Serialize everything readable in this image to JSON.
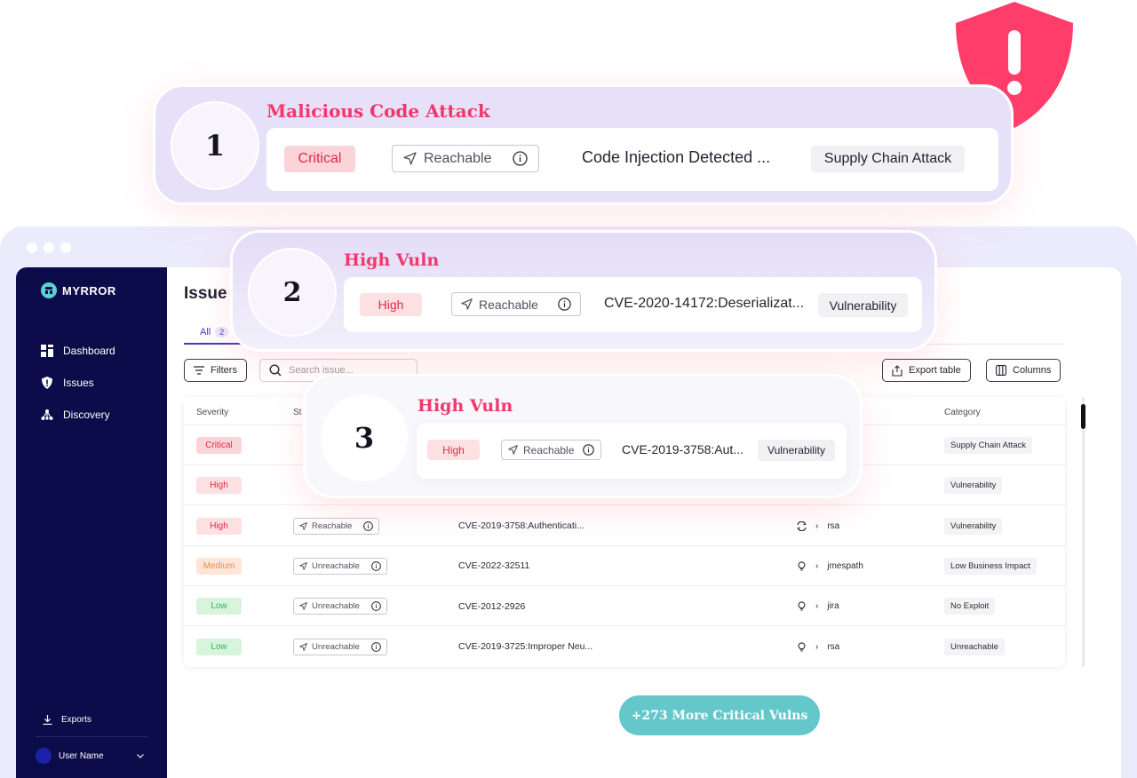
{
  "app": {
    "brand": "MYRROR",
    "sidebar": {
      "items": [
        {
          "label": "Dashboard",
          "icon": "dashboard-icon"
        },
        {
          "label": "Issues",
          "icon": "shield-icon"
        },
        {
          "label": "Discovery",
          "icon": "discovery-icon"
        }
      ],
      "exports_label": "Exports",
      "user_name": "User Name"
    }
  },
  "main": {
    "page_title": "Issue",
    "tab_all_label": "All",
    "tab_all_count": "2",
    "filters_label": "Filters",
    "search_placeholder": "Search issue...",
    "export_label": "Export table",
    "columns_label": "Columns",
    "table": {
      "headers": {
        "severity": "Severity",
        "status": "St",
        "category": "Category"
      },
      "rows": [
        {
          "severity": "Critical",
          "sev_color": "#fbd4d9",
          "sev_text": "#e02a47",
          "reach": "",
          "issue": "",
          "dep": "",
          "category": "Supply Chain Attack"
        },
        {
          "severity": "High",
          "sev_color": "#fde0e2",
          "sev_text": "#e02a47",
          "reach": "",
          "issue": "",
          "dep": "",
          "category": "Vulnerability"
        },
        {
          "severity": "High",
          "sev_color": "#fde0e2",
          "sev_text": "#e02a47",
          "reach": "Reachable",
          "issue": "CVE-2019-3758:Authenticati...",
          "dep": "rsa",
          "dep_icon": "sync-icon",
          "category": "Vulnerability"
        },
        {
          "severity": "Medium",
          "sev_color": "#fde6d8",
          "sev_text": "#f08a4b",
          "reach": "Unreachable",
          "issue": "CVE-2022-32511",
          "dep": "jmespath",
          "dep_icon": "bulb-icon",
          "category": "Low Business Impact"
        },
        {
          "severity": "Low",
          "sev_color": "#d6f5dc",
          "sev_text": "#3fae5b",
          "reach": "Unreachable",
          "issue": "CVE-2012-2926",
          "dep": "jira",
          "dep_icon": "bulb-icon",
          "category": "No Exploit"
        },
        {
          "severity": "Low",
          "sev_color": "#d6f5dc",
          "sev_text": "#3fae5b",
          "reach": "Unreachable",
          "issue": "CVE-2019-3725:Improper Neu...",
          "dep": "rsa",
          "dep_icon": "bulb-icon",
          "category": "Unreachable"
        }
      ]
    },
    "more_button": "+273 More Critical Vulns"
  },
  "cards": [
    {
      "number": "1",
      "title": "Malicious Code Attack",
      "severity": "Critical",
      "reach": "Reachable",
      "text": "Code Injection Detected ...",
      "category": "Supply Chain Attack"
    },
    {
      "number": "2",
      "title": "High Vuln",
      "severity": "High",
      "reach": "Reachable",
      "text": "CVE-2020-14172:Deserializat...",
      "category": "Vulnerability"
    },
    {
      "number": "3",
      "title": "High Vuln",
      "severity": "High",
      "reach": "Reachable",
      "text": "CVE-2019-3758:Aut...",
      "category": "Vulnerability"
    }
  ],
  "colors": {
    "accent": "#f0386b",
    "sidebar": "#0d0c4a",
    "teal": "#64c7c9"
  }
}
